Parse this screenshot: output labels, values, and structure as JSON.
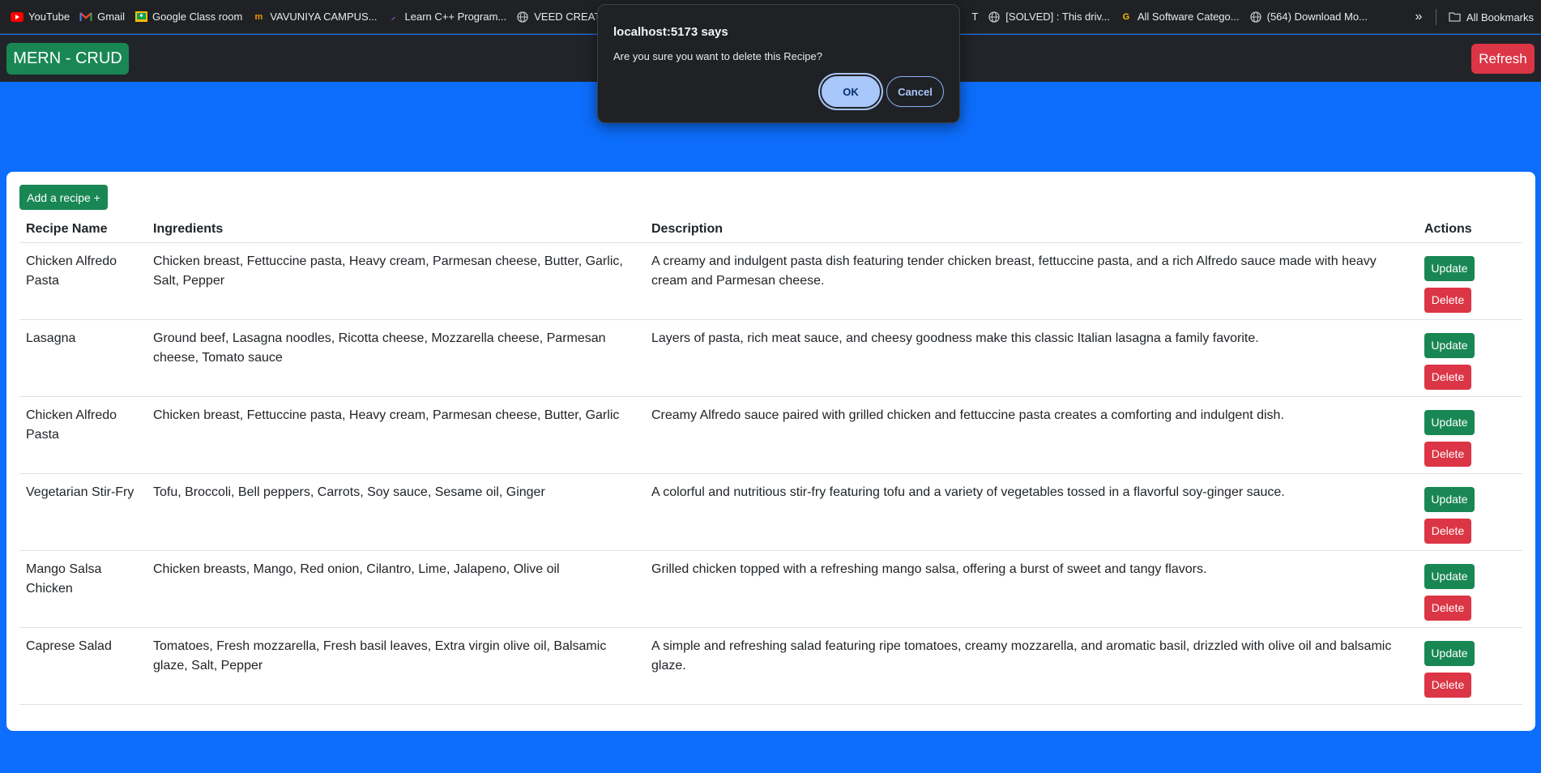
{
  "bookmarks": {
    "items": [
      {
        "label": "YouTube",
        "icon": "youtube-icon"
      },
      {
        "label": "Gmail",
        "icon": "gmail-icon"
      },
      {
        "label": "Google Class room",
        "icon": "classroom-icon"
      },
      {
        "label": "VAVUNIYA CAMPUS...",
        "icon": "campus-icon"
      },
      {
        "label": "Learn C++ Program...",
        "icon": "cpp-icon"
      },
      {
        "label": "VEED CREATE | E",
        "icon": "globe-icon"
      },
      {
        "label": "T",
        "icon": ""
      },
      {
        "label": "[SOLVED] : This driv...",
        "icon": "globe-icon"
      },
      {
        "label": "All Software Catego...",
        "icon": "g-icon"
      },
      {
        "label": "(564) Download Mo...",
        "icon": "globe-icon"
      }
    ],
    "all_bookmarks": "All Bookmarks"
  },
  "navbar": {
    "brand": "MERN - CRUD",
    "refresh": "Refresh"
  },
  "card": {
    "add_button": "Add a recipe +",
    "headers": {
      "name": "Recipe Name",
      "ingredients": "Ingredients",
      "description": "Description",
      "actions": "Actions"
    },
    "update_label": "Update",
    "delete_label": "Delete",
    "rows": [
      {
        "name": "Chicken Alfredo Pasta",
        "ingredients": "Chicken breast, Fettuccine pasta, Heavy cream, Parmesan cheese, Butter, Garlic, Salt, Pepper",
        "description": "A creamy and indulgent pasta dish featuring tender chicken breast, fettuccine pasta, and a rich Alfredo sauce made with heavy cream and Parmesan cheese."
      },
      {
        "name": "Lasagna",
        "ingredients": "Ground beef, Lasagna noodles, Ricotta cheese, Mozzarella cheese, Parmesan cheese, Tomato sauce",
        "description": "Layers of pasta, rich meat sauce, and cheesy goodness make this classic Italian lasagna a family favorite."
      },
      {
        "name": "Chicken Alfredo Pasta",
        "ingredients": "Chicken breast, Fettuccine pasta, Heavy cream, Parmesan cheese, Butter, Garlic",
        "description": "Creamy Alfredo sauce paired with grilled chicken and fettuccine pasta creates a comforting and indulgent dish."
      },
      {
        "name": "Vegetarian Stir-Fry",
        "ingredients": "Tofu, Broccoli, Bell peppers, Carrots, Soy sauce, Sesame oil, Ginger",
        "description": "A colorful and nutritious stir-fry featuring tofu and a variety of vegetables tossed in a flavorful soy-ginger sauce."
      },
      {
        "name": "Mango Salsa Chicken",
        "ingredients": "Chicken breasts, Mango, Red onion, Cilantro, Lime, Jalapeno, Olive oil",
        "description": "Grilled chicken topped with a refreshing mango salsa, offering a burst of sweet and tangy flavors."
      },
      {
        "name": "Caprese Salad",
        "ingredients": "Tomatoes, Fresh mozzarella, Fresh basil leaves, Extra virgin olive oil, Balsamic glaze, Salt, Pepper",
        "description": "A simple and refreshing salad featuring ripe tomatoes, creamy mozzarella, and aromatic basil, drizzled with olive oil and balsamic glaze."
      }
    ]
  },
  "dialog": {
    "title": "localhost:5173 says",
    "message": "Are you sure you want to delete this Recipe?",
    "ok": "OK",
    "cancel": "Cancel"
  },
  "colors": {
    "background": "#0d6efd",
    "navbar": "#212529",
    "success": "#198754",
    "danger": "#dc3545"
  }
}
